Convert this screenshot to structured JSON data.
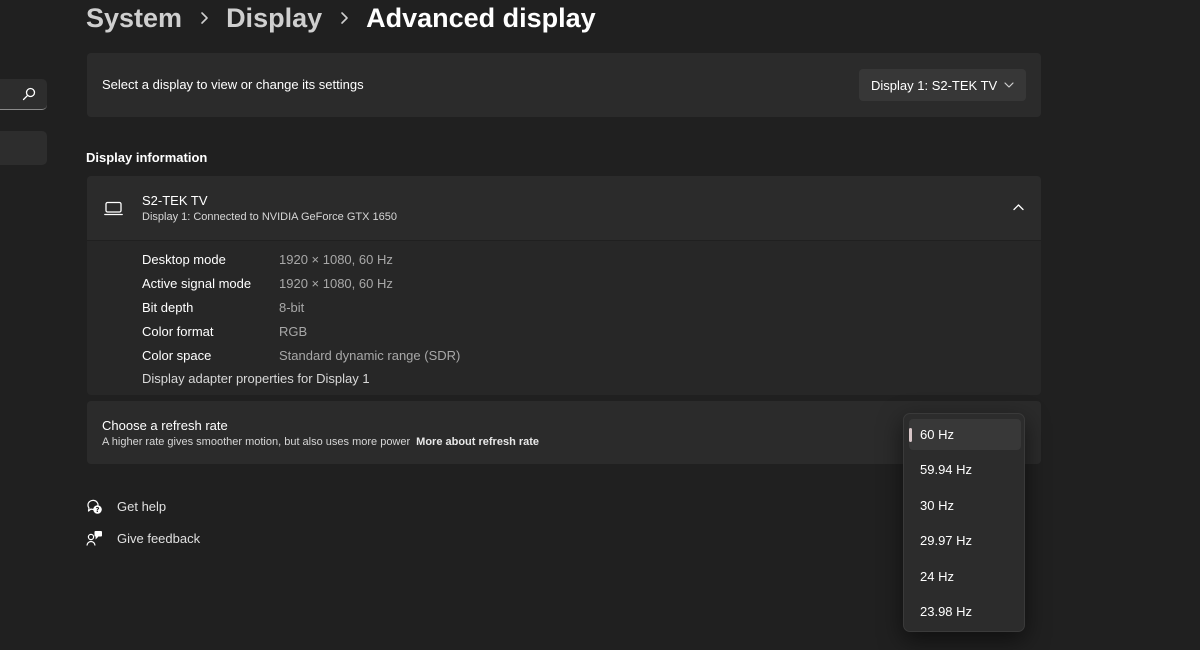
{
  "breadcrumb": {
    "items": [
      "System",
      "Display"
    ],
    "current": "Advanced display"
  },
  "display_select": {
    "label": "Select a display to view or change its settings",
    "selected": "Display 1: S2-TEK TV"
  },
  "display_info": {
    "heading": "Display information",
    "name": "S2-TEK TV",
    "connection": "Display 1: Connected to NVIDIA GeForce GTX 1650",
    "properties": [
      {
        "label": "Desktop mode",
        "value": "1920 × 1080, 60 Hz"
      },
      {
        "label": "Active signal mode",
        "value": "1920 × 1080, 60 Hz"
      },
      {
        "label": "Bit depth",
        "value": "8-bit"
      },
      {
        "label": "Color format",
        "value": "RGB"
      },
      {
        "label": "Color space",
        "value": "Standard dynamic range (SDR)"
      }
    ],
    "adapter_link": "Display adapter properties for Display 1"
  },
  "refresh_rate": {
    "title": "Choose a refresh rate",
    "description": "A higher rate gives smoother motion, but also uses more power",
    "link": "More about refresh rate",
    "options": [
      "60 Hz",
      "59.94 Hz",
      "30 Hz",
      "29.97 Hz",
      "24 Hz",
      "23.98 Hz"
    ],
    "selected": "60 Hz"
  },
  "help": {
    "get_help": "Get help",
    "give_feedback": "Give feedback"
  },
  "icons": {
    "search": "search-icon",
    "monitor": "monitor-icon",
    "chevron": "chevron-down-icon",
    "collapse": "chevron-up-icon",
    "help": "help-icon",
    "feedback": "feedback-icon"
  },
  "colors": {
    "background": "#202020",
    "card": "#2b2b2b",
    "text": "#ffffff",
    "secondary_text": "#a8a8a8",
    "flyout": "#2c2c2c",
    "selection_indicator": "#d8c6c8"
  }
}
